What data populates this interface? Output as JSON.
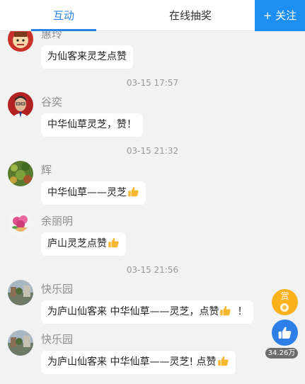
{
  "tabs": {
    "interaction": "互动",
    "lottery": "在线抽奖"
  },
  "follow_button": "+ 关注",
  "timestamps": [
    "03-15 17:57",
    "03-15 21:32",
    "03-15 21:56"
  ],
  "messages": [
    {
      "user": "惠玲",
      "text": "为仙客来灵芝点赞",
      "avatar_icon": "cartoon-avatar"
    },
    {
      "user": "谷奕",
      "text": "中华仙草灵芝，赞！",
      "avatar_icon": "man-photo-avatar"
    },
    {
      "user": "辉",
      "text": "中华仙草——灵芝",
      "avatar_icon": "garden-avatar"
    },
    {
      "user": "余丽明",
      "text": "庐山灵芝点赞",
      "avatar_icon": "flower-avatar"
    },
    {
      "user": "快乐园",
      "text": "为庐山仙客来 中华仙草——灵芝，点赞",
      "text_after": "！",
      "avatar_icon": "street-avatar"
    },
    {
      "user": "快乐园",
      "text": "为庐山仙客来 中华仙草——灵芝! 点赞",
      "avatar_icon": "street-avatar"
    }
  ],
  "reward_label": "赏",
  "like_count": "34.26万",
  "colors": {
    "accent": "#2a82e4",
    "follow_bg": "#1e8ff2",
    "reward": "#f9b11c",
    "thumb_emoji": "#f6b830"
  }
}
